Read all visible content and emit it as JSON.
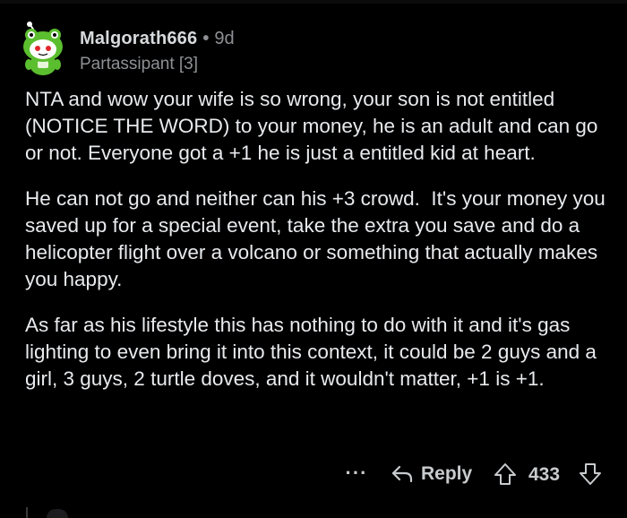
{
  "comment": {
    "author": "Malgorath666",
    "separator": "•",
    "age": "9d",
    "flair": "Partassipant [3]",
    "avatar_icon": "snoo-avatar-icon",
    "paragraphs": [
      "NTA and wow your wife is so wrong, your son is not entitled (NOTICE THE WORD) to your money, he is an adult and can go or not. Everyone got a +1 he is just a entitled kid at heart.",
      "He can not go and neither can his +3 crowd.  It's your money you saved up for a special event, take the extra you save and do a helicopter flight over a volcano or something that actually makes you happy.",
      "As far as his lifestyle this has nothing to do with it and it's gas lighting to even bring it into this context, it could be 2 guys and a girl, 3 guys, 2 turtle doves, and it wouldn't matter, +1 is +1."
    ]
  },
  "actions": {
    "more_label": "···",
    "reply_label": "Reply",
    "reply_icon": "reply-arrow-icon",
    "upvote_icon": "upvote-arrow-icon",
    "score": "433",
    "downvote_icon": "downvote-arrow-icon"
  },
  "colors": {
    "background": "#000000",
    "text": "#E8EAED",
    "muted": "#8E9093",
    "avatar_green": "#4CAF2C",
    "avatar_red": "#E0262C"
  }
}
